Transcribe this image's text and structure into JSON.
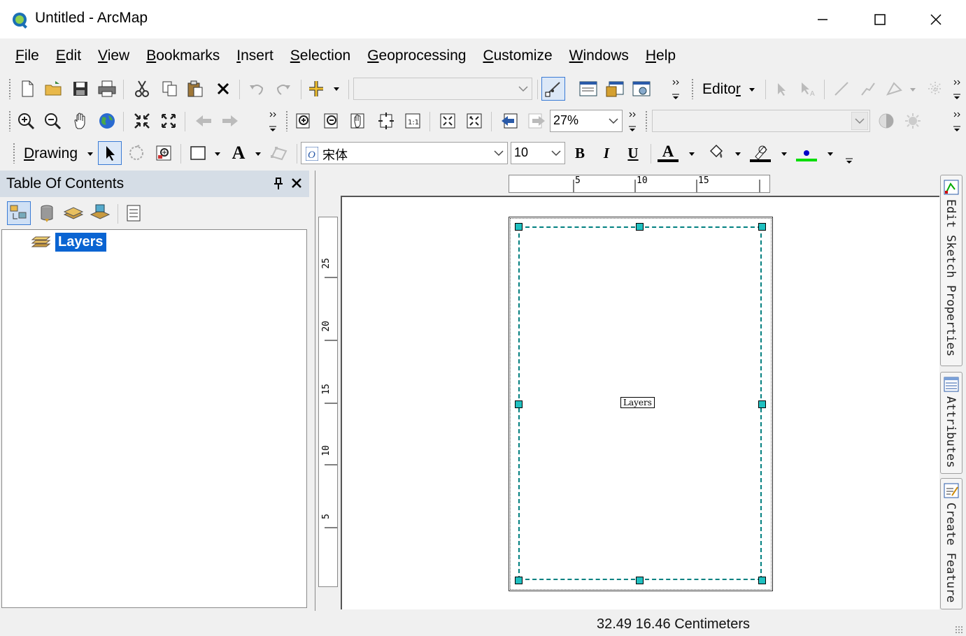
{
  "window": {
    "title": "Untitled - ArcMap",
    "minimize_icon": "minimize-icon",
    "maximize_icon": "maximize-icon",
    "close_icon": "close-icon"
  },
  "menu": [
    {
      "first": "F",
      "rest": "ile"
    },
    {
      "first": "E",
      "rest": "dit"
    },
    {
      "first": "V",
      "rest": "iew"
    },
    {
      "first": "B",
      "rest": "ookmarks"
    },
    {
      "first": "I",
      "rest": "nsert"
    },
    {
      "first": "S",
      "rest": "election"
    },
    {
      "first": "G",
      "rest": "eoprocessing"
    },
    {
      "first": "C",
      "rest": "ustomize"
    },
    {
      "first": "W",
      "rest": "indows"
    },
    {
      "first": "H",
      "rest": "elp"
    }
  ],
  "standard_toolbar": {
    "editor_label": "Editor",
    "editor_first": "Edito",
    "editor_rest": "r"
  },
  "tools_toolbar": {
    "scale_value": "27%"
  },
  "draw_toolbar": {
    "drawing_first": "D",
    "drawing_rest": "rawing",
    "font_name": "宋体",
    "font_size": "10",
    "bold": "B",
    "italic": "I",
    "underline": "U",
    "text_tool": "A",
    "font_color": "A",
    "colors": {
      "font_underline": "#000000",
      "line_color": "#000000",
      "marker_color": "#00dd00",
      "marker_dot": "#0000c8",
      "accent": "#0a64d2"
    }
  },
  "toc": {
    "title": "Table Of Contents",
    "pin": "pin-icon",
    "close": "close-icon",
    "layers_label": "Layers"
  },
  "layout": {
    "h_ruler_ticks": [
      "5",
      "10",
      "15"
    ],
    "v_ruler_ticks": [
      "25",
      "20",
      "15",
      "10",
      "5"
    ],
    "data_frame_label": "Layers"
  },
  "side_tabs": [
    {
      "label": "Edit Sketch Properties"
    },
    {
      "label": "Attributes"
    },
    {
      "label": "Create Feature"
    }
  ],
  "status": {
    "coords": "32.49  16.46 Centimeters"
  }
}
